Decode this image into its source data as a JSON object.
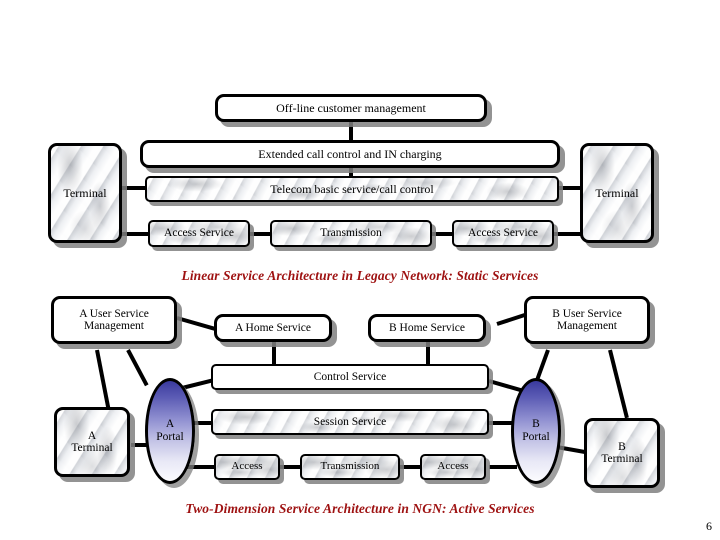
{
  "slide": {
    "page_number": "6",
    "caption_color": "#9e1111"
  },
  "diagram_legacy": {
    "caption": "Linear Service Architecture in Legacy Network: Static Services",
    "nodes": {
      "offline_customer_management": "Off-line customer management",
      "extended_call_control": "Extended call control and IN charging",
      "telecom_basic_service": "Telecom basic service/call control",
      "terminal_left": "Terminal",
      "terminal_right": "Terminal",
      "access_service_left": "Access Service",
      "transmission": "Transmission",
      "access_service_right": "Access Service"
    }
  },
  "diagram_ngn": {
    "caption": "Two-Dimension Service Architecture in NGN: Active Services",
    "nodes": {
      "a_user_service_management_line1": "A User Service",
      "a_user_service_management_line2": "Management",
      "b_user_service_management_line1": "B User Service",
      "b_user_service_management_line2": "Management",
      "a_home_service": "A Home Service",
      "b_home_service": "B Home Service",
      "control_service": "Control Service",
      "session_service": "Session Service",
      "a_portal_line1": "A",
      "a_portal_line2": "Portal",
      "b_portal_line1": "B",
      "b_portal_line2": "Portal",
      "a_terminal_line1": "A",
      "a_terminal_line2": "Terminal",
      "b_terminal_line1": "B",
      "b_terminal_line2": "Terminal",
      "access_left": "Access",
      "transmission": "Transmission",
      "access_right": "Access"
    }
  }
}
